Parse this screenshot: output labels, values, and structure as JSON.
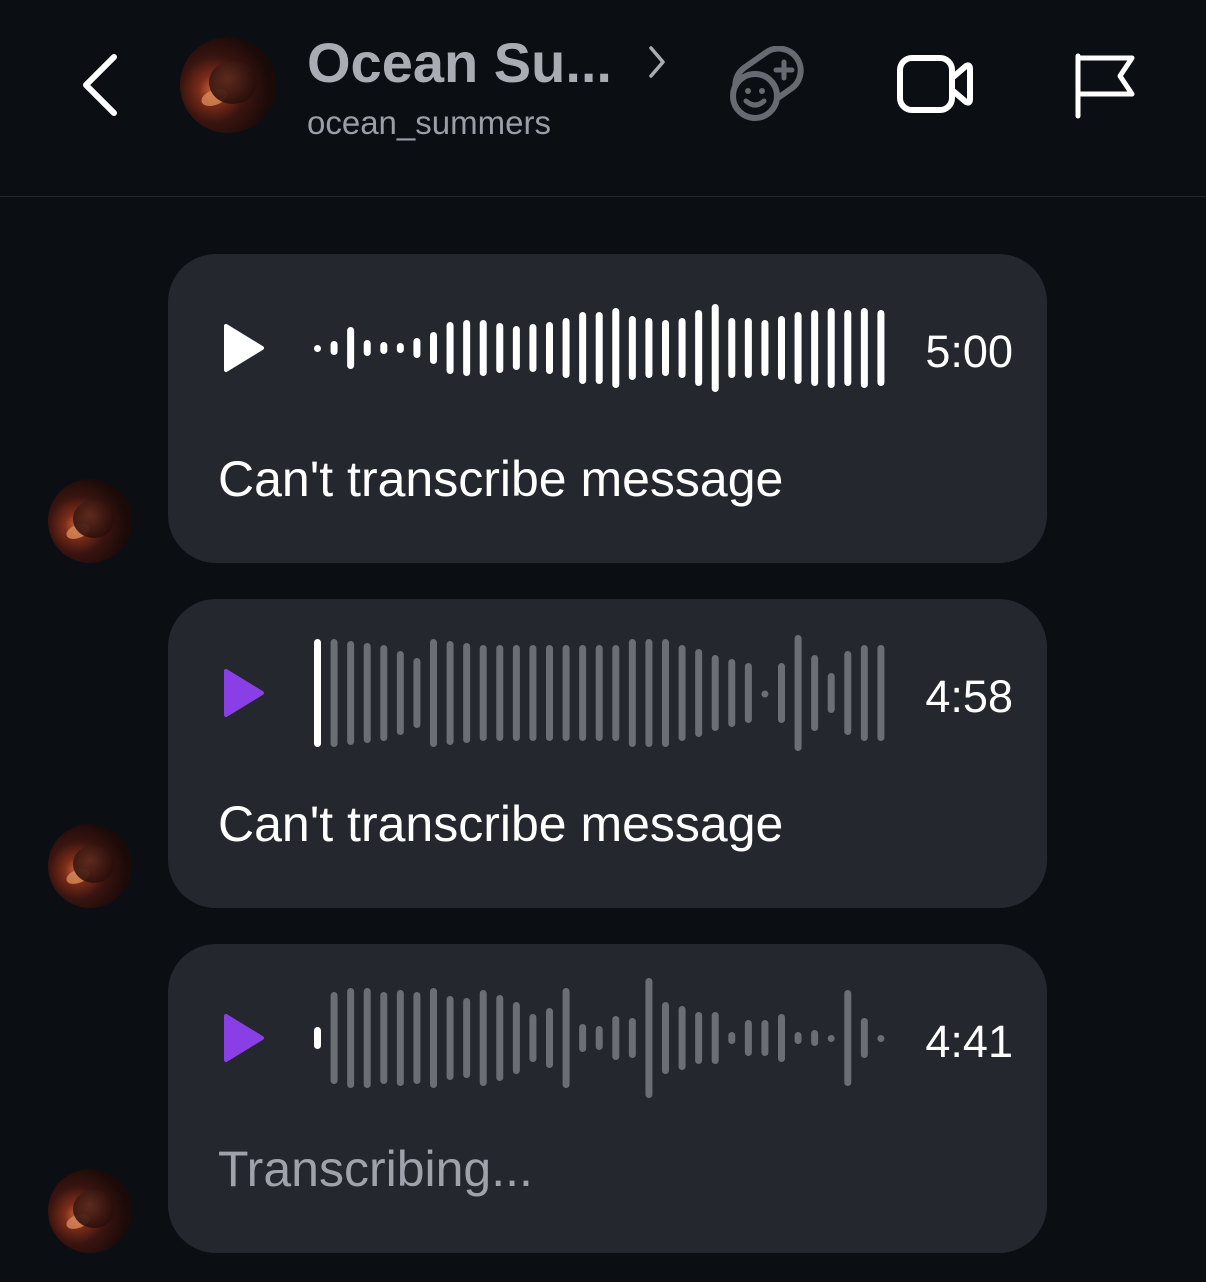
{
  "header": {
    "back_icon": "chevron-left-icon",
    "contact_name": "Ocean Su...",
    "contact_username": "ocean_summers",
    "chevron_icon": "chevron-right-icon",
    "effects_icon": "effects-add-icon",
    "video_icon": "video-call-icon",
    "flag_icon": "report-flag-icon"
  },
  "messages": [
    {
      "duration": "5:00",
      "caption": "Can't transcribe message",
      "play_color": "#ffffff",
      "played": true
    },
    {
      "duration": "4:58",
      "caption": "Can't transcribe message",
      "play_color": "#8a3ee6",
      "played": false
    },
    {
      "duration": "4:41",
      "caption": "Transcribing...",
      "play_color": "#8a3ee6",
      "played": false
    }
  ],
  "colors": {
    "background": "#0b0e13",
    "bubble": "#24272e",
    "accent_purple": "#8a3ee6",
    "wave_played": "#ffffff",
    "wave_unplayed": "#6b6e74"
  }
}
